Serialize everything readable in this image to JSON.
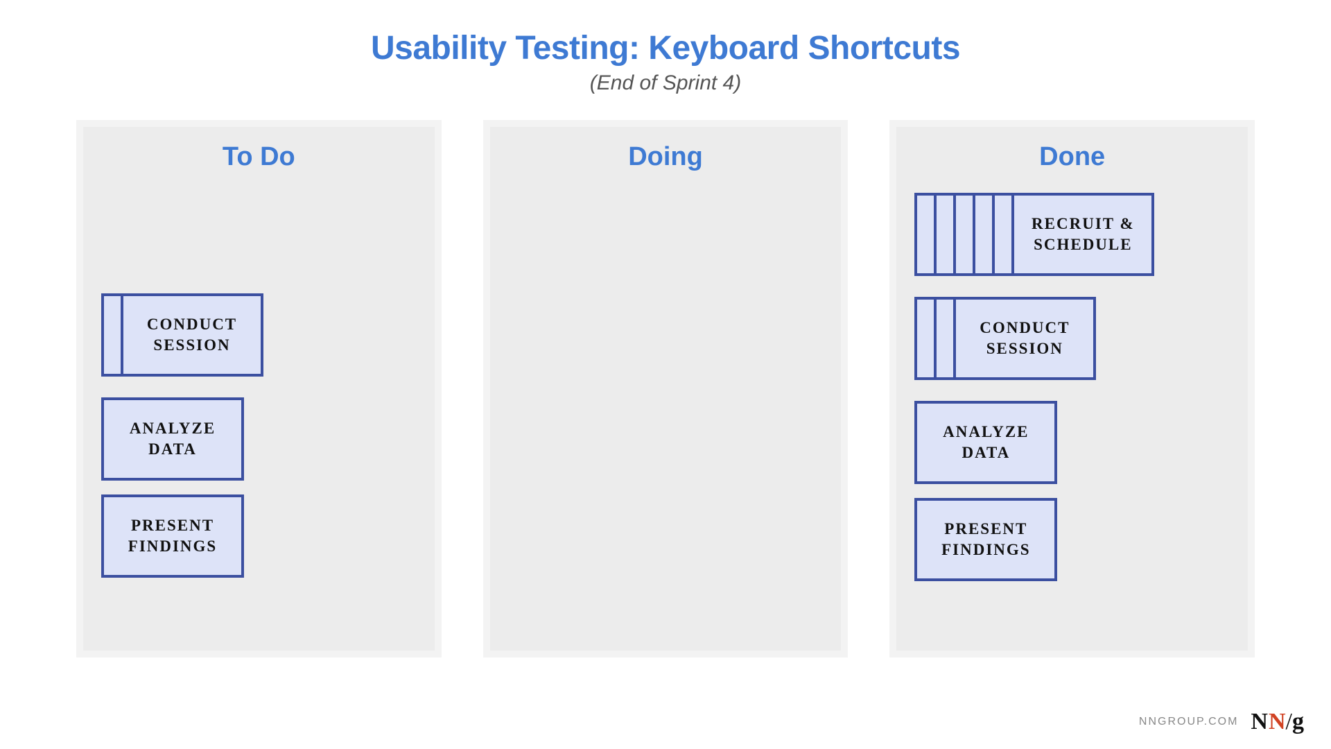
{
  "header": {
    "title": "Usability Testing: Keyboard Shortcuts",
    "subtitle": "(End of Sprint 4)"
  },
  "columns": {
    "todo": {
      "title": "To Do",
      "cards": {
        "conduct": {
          "label": "Conduct Session",
          "stack_count": 2
        },
        "analyze": {
          "label": "Analyze Data"
        },
        "present": {
          "label": "Present Findings"
        }
      }
    },
    "doing": {
      "title": "Doing"
    },
    "done": {
      "title": "Done",
      "cards": {
        "recruit": {
          "label": "Recruit & Schedule",
          "stack_count": 6
        },
        "conduct": {
          "label": "Conduct Session",
          "stack_count": 3
        },
        "analyze": {
          "label": "Analyze Data"
        },
        "present": {
          "label": "Present Findings"
        }
      }
    }
  },
  "footer": {
    "url": "NNGROUP.COM",
    "logo": {
      "n1": "N",
      "n2": "N",
      "slash": "/",
      "g": "g"
    }
  },
  "colors": {
    "accent": "#3e7ad3",
    "card_border": "#3b4fa0",
    "card_fill": "#dde3f8",
    "column_fill": "#ececec"
  }
}
